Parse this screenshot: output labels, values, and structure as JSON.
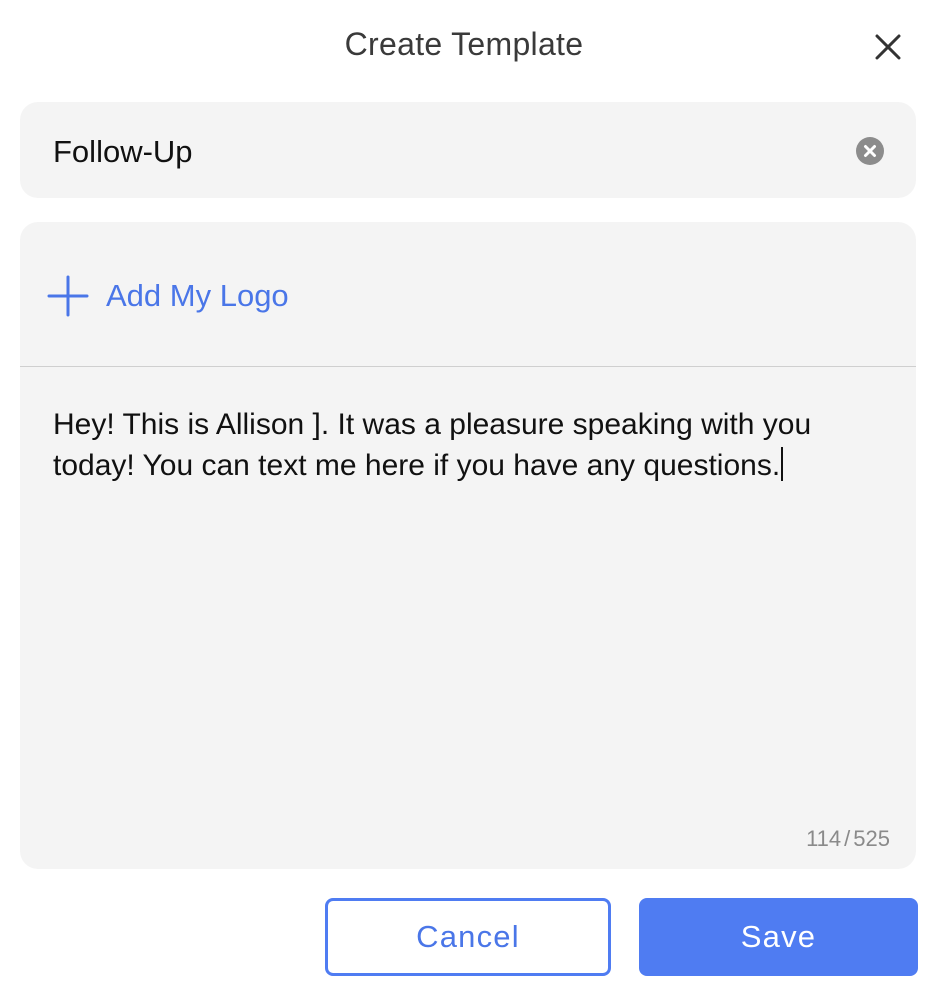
{
  "dialog": {
    "title": "Create Template"
  },
  "template_name": {
    "value": "Follow-Up"
  },
  "editor": {
    "add_logo_label": "Add My Logo",
    "message": "Hey! This is Allison ]. It was a pleasure speaking with you today! You can text me here if you have any questions.",
    "char_count": "114",
    "char_limit": "525"
  },
  "actions": {
    "cancel_label": "Cancel",
    "save_label": "Save"
  },
  "colors": {
    "accent": "#4f7cf2",
    "field_bg": "#f4f4f4",
    "muted_text": "#8a8a8a"
  },
  "icons": {
    "close": "close-icon",
    "clear": "clear-circle-icon",
    "add": "plus-icon"
  }
}
